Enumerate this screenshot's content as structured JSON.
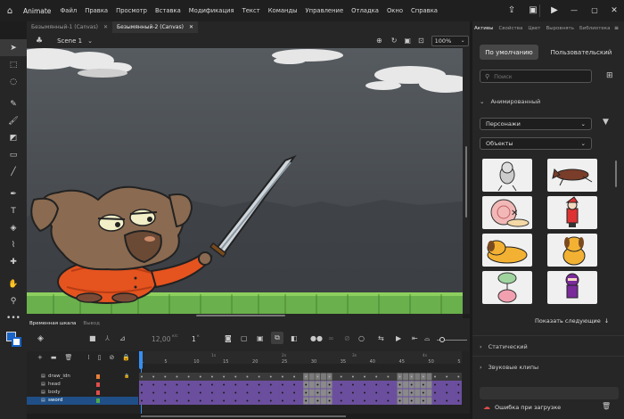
{
  "app": {
    "name": "Animate"
  },
  "menu": [
    "Файл",
    "Правка",
    "Просмотр",
    "Вставка",
    "Модификация",
    "Текст",
    "Команды",
    "Управление",
    "Отладка",
    "Окно",
    "Справка"
  ],
  "document_tabs": [
    {
      "label": "Безымянный-1 (Canvas)",
      "active": false
    },
    {
      "label": "Безымянный-2 (Canvas)",
      "active": true
    }
  ],
  "scene": {
    "label": "Scene 1",
    "zoom": "100%"
  },
  "timeline": {
    "tabs": [
      "Временная шкала",
      "Вывод"
    ],
    "fps": "12,00",
    "fps_unit": "к/с",
    "frame": "1",
    "frame_unit": "к",
    "ruler_secs": [
      "1s",
      "2s",
      "3s",
      "4s"
    ],
    "ruler_marks": [
      "1",
      "5",
      "10",
      "15",
      "20",
      "25",
      "30",
      "35",
      "40",
      "45",
      "50",
      "5"
    ],
    "layers": [
      {
        "name": "draw_idn",
        "color": "#e9803a",
        "selected": false
      },
      {
        "name": "head",
        "color": "#e04d4d",
        "selected": false
      },
      {
        "name": "body",
        "color": "#e04d4d",
        "selected": false
      },
      {
        "name": "sword",
        "color": "#4caa4c",
        "selected": true
      }
    ]
  },
  "right_panel": {
    "tabs": [
      "Активы",
      "Свойства",
      "Цвет",
      "Выровнять",
      "Библиотека"
    ],
    "active_tab": "Активы",
    "buttons": {
      "default": "По умолчанию",
      "custom": "Пользовательский"
    },
    "search_placeholder": "Поиск",
    "section_animated": "Анимированный",
    "dropdown_characters": "Персонажи",
    "dropdown_objects": "Объекты",
    "show_more": "Показать следующие",
    "section_static": "Статический",
    "section_sound": "Звуковые клипы",
    "status_error": "Ошибка при загрузке"
  },
  "colors": {
    "accent": "#378ef0",
    "stage_sky": "#4a4e52",
    "ground": "#6ab04c",
    "frames_purple": "#6b4f9e"
  }
}
